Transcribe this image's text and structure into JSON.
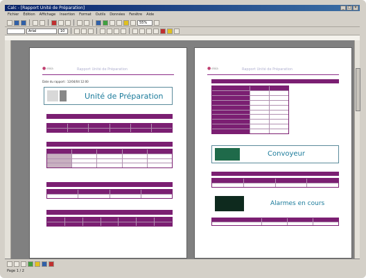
{
  "window": {
    "title": "Calc - [Rapport Unité de Préparation]"
  },
  "menu": [
    "Fichier",
    "Édition",
    "Affichage",
    "Insertion",
    "Format",
    "Outils",
    "Données",
    "Fenêtre",
    "Aide"
  ],
  "font_box": {
    "font": "Arial",
    "size": "10"
  },
  "page1": {
    "header_title": "Rapport Unité de Préparation",
    "date_line": "Date du rapport : 12/04/04 12:00",
    "unit_title": "Unité de Préparation"
  },
  "page2": {
    "header_title": "Rapport Unité de Préparation",
    "convoyeur": "Convoyeur",
    "alarmes": "Alarmes en cours"
  },
  "status": {
    "page": "Page 1 / 2",
    "zoom": "55%"
  },
  "colors": {
    "accent": "#7b1f72",
    "link": "#1a7a9a"
  }
}
